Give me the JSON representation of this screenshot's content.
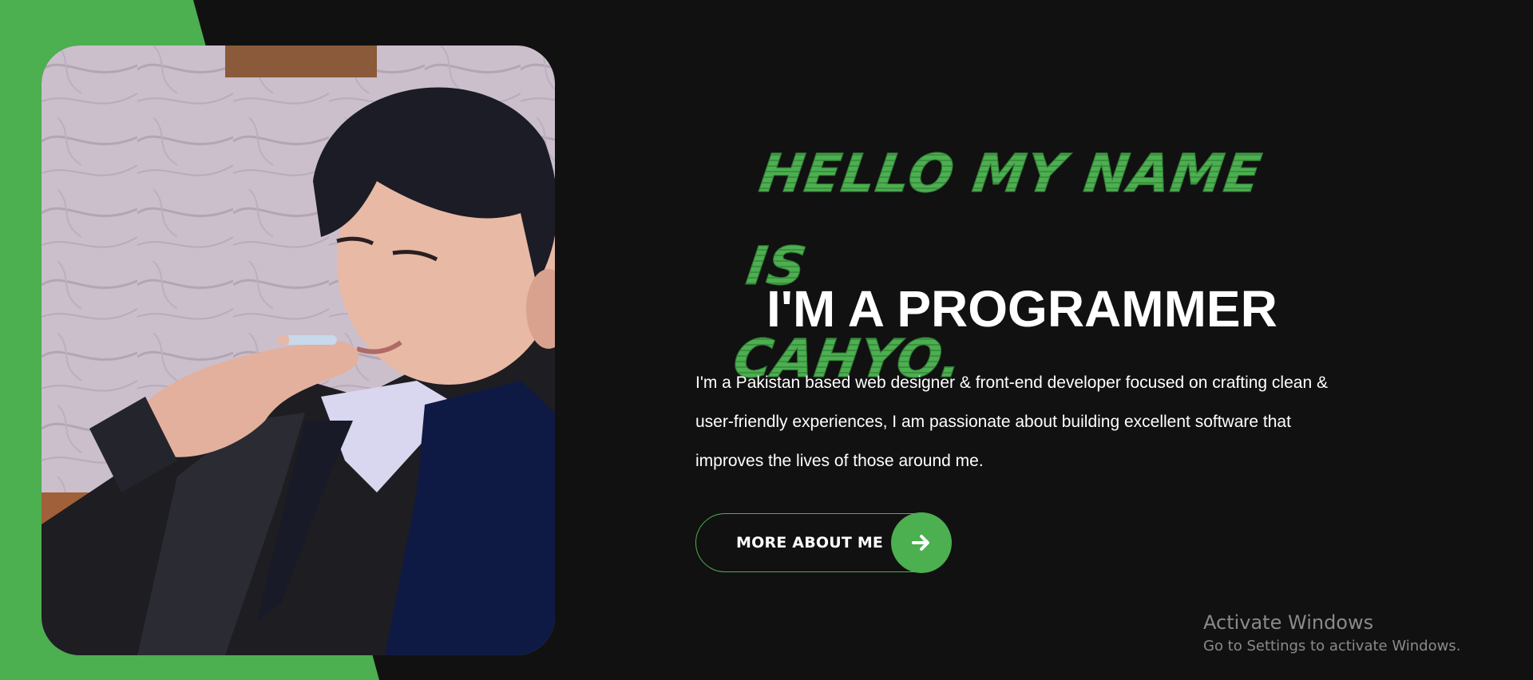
{
  "colors": {
    "accent": "#4caf50",
    "background": "#111111",
    "text": "#ffffff"
  },
  "hero": {
    "greeting_line1": "HELLO MY NAME IS",
    "greeting_line2": "CAHYO.",
    "role": "I'M A PROGRAMMER",
    "bio": "I'm a Pakistan based web designer & front-end developer focused on crafting clean & user-friendly experiences, I am passionate about building excellent software that improves the lives of those around me.",
    "button_label": "MORE ABOUT ME",
    "button_icon": "arrow-right-icon"
  },
  "profile_photo": {
    "icon": "portrait-photo"
  },
  "watermark": {
    "title": "Activate Windows",
    "subtitle": "Go to Settings to activate Windows."
  }
}
